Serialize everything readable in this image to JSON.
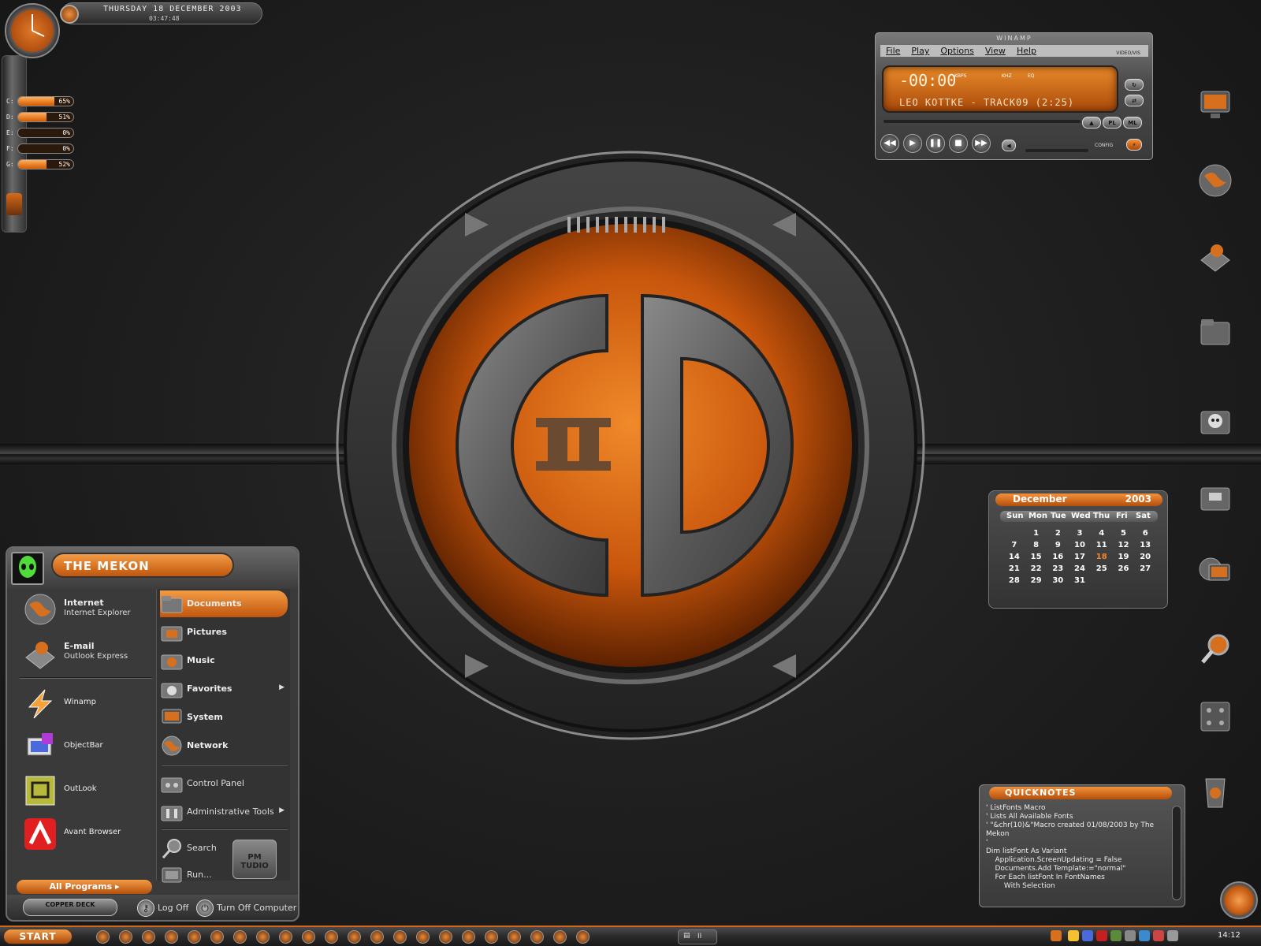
{
  "sysmeter": {
    "date": "THURSDAY 18 DECEMBER 2003",
    "time": "03:47:48",
    "drives": [
      {
        "letter": "C:",
        "percent": "65%",
        "fill": 0.65
      },
      {
        "letter": "D:",
        "percent": "51%",
        "fill": 0.51
      },
      {
        "letter": "E:",
        "percent": "0%",
        "fill": 0
      },
      {
        "letter": "F:",
        "percent": "0%",
        "fill": 0
      },
      {
        "letter": "G:",
        "percent": "52%",
        "fill": 0.52
      }
    ]
  },
  "winamp": {
    "title": "WINAMP",
    "menu": [
      "File",
      "Play",
      "Options",
      "View",
      "Help"
    ],
    "video_vis": "VIDEO/VIS",
    "time": "-00:00",
    "kbps": "KBPS",
    "khz": "KHZ",
    "eq": "EQ",
    "song": "LEO KOTTKE - TRACK09 (2:25)",
    "buttons": [
      "PL",
      "ML"
    ],
    "config": "CONFIG"
  },
  "calendar": {
    "month": "December",
    "year": "2003",
    "days": [
      "Sun",
      "Mon",
      "Tue",
      "Wed",
      "Thu",
      "Fri",
      "Sat"
    ],
    "weeks": [
      [
        "",
        "1",
        "2",
        "3",
        "4",
        "5",
        "6"
      ],
      [
        "7",
        "8",
        "9",
        "10",
        "11",
        "12",
        "13"
      ],
      [
        "14",
        "15",
        "16",
        "17",
        "18",
        "19",
        "20"
      ],
      [
        "21",
        "22",
        "23",
        "24",
        "25",
        "26",
        "27"
      ],
      [
        "28",
        "29",
        "30",
        "31",
        "",
        "",
        ""
      ]
    ],
    "today": "18",
    "today_color": "#f08a2a"
  },
  "start_menu": {
    "user": "THE MEKON",
    "pinned": [
      {
        "title": "Internet",
        "subtitle": "Internet Explorer"
      },
      {
        "title": "E-mail",
        "subtitle": "Outlook Express"
      }
    ],
    "recent": [
      "Winamp",
      "ObjectBar",
      "OutLook",
      "Avant Browser"
    ],
    "all_programs": "All Programs",
    "places": [
      "Documents",
      "Pictures",
      "Music",
      "Favorites",
      "System",
      "Network"
    ],
    "settings": [
      "Control Panel",
      "Administrative Tools"
    ],
    "tools": [
      "Search",
      "Run..."
    ],
    "copper_deck": "COPPER DECK",
    "log_off": "Log Off",
    "turn_off": "Turn Off Computer",
    "studio_label": "PM TUDIO"
  },
  "quicknotes": {
    "title": "QUICKNOTES",
    "lines": [
      "' ListFonts Macro",
      "' Lists All Available Fonts",
      "' \"&chr(10)&\"Macro created 01/08/2003 by The",
      "Mekon",
      "'",
      "Dim listFont As Variant",
      "    Application.ScreenUpdating = False",
      "    Documents.Add Template:=\"normal\"",
      "    For Each listFont In FontNames",
      "        With Selection"
    ]
  },
  "taskbar": {
    "start": "START",
    "task_label": "II",
    "clock": "14:12"
  },
  "colors": {
    "accent": "#e0721e",
    "background": "#1e1e1e",
    "panel": "#3a3a3a"
  },
  "emblem": {
    "label": "II"
  }
}
